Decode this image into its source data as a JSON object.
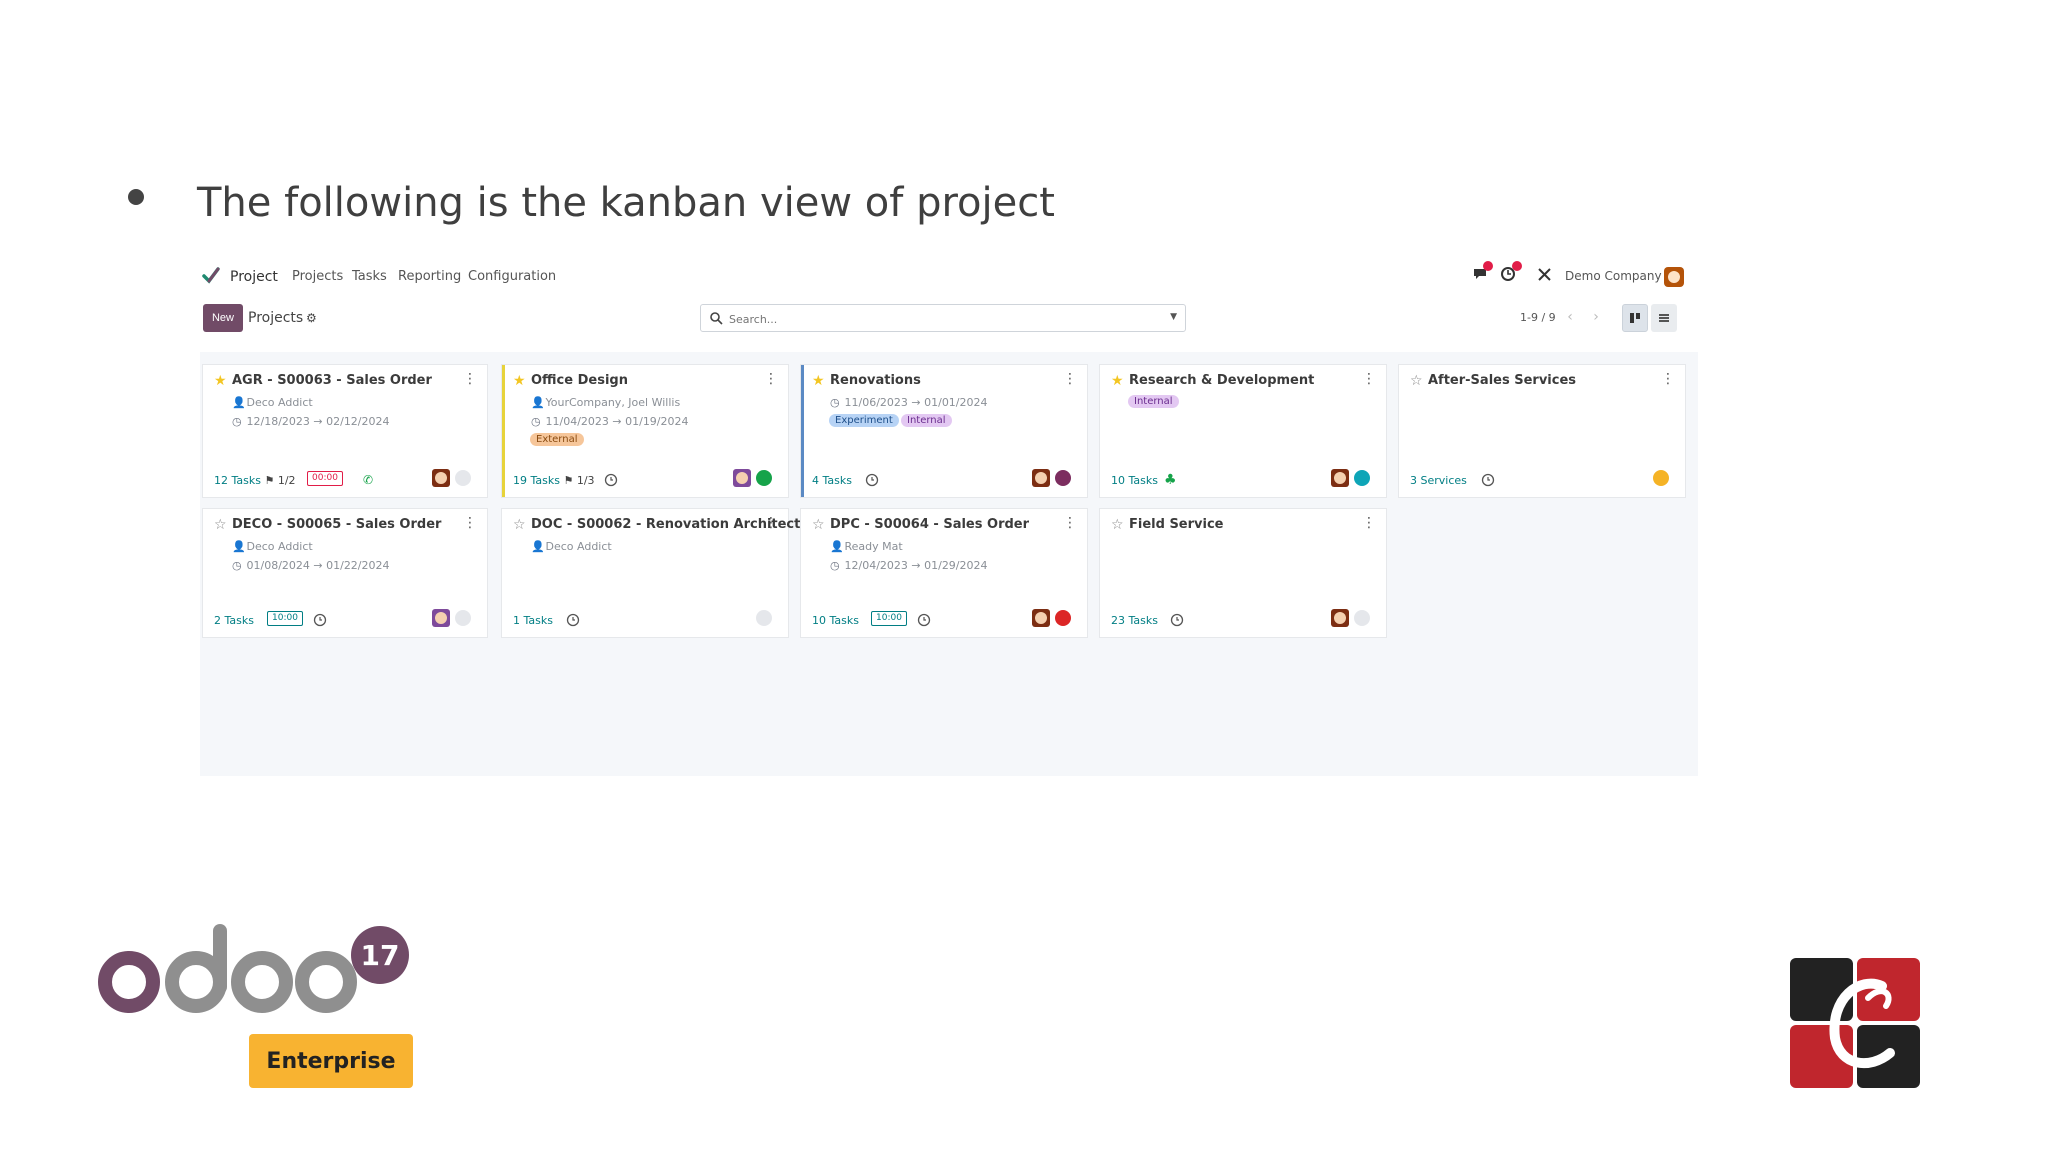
{
  "slide": {
    "heading": "The following is the kanban view of project"
  },
  "topnav": {
    "app": "Project",
    "menu": [
      "Projects",
      "Tasks",
      "Reporting",
      "Configuration"
    ],
    "company": "Demo Company"
  },
  "control": {
    "new_label": "New",
    "breadcrumb": "Projects",
    "search_placeholder": "Search...",
    "pager": "1-9 / 9"
  },
  "colors": {
    "primary": "#714b67",
    "link": "#017e84",
    "board_bg": "#f5f7fa"
  },
  "cards": [
    {
      "title": "AGR - S00063 - Sales Order",
      "favorite": true,
      "customer": "Deco Addict",
      "dates": "12/18/2023 → 02/12/2024",
      "tasks": "12 Tasks",
      "milestones": "1/2",
      "hours": "00:00",
      "hours_color": "#e11d48",
      "status_color": "#e5e7eb"
    },
    {
      "title": "Office Design",
      "favorite": true,
      "customer": "YourCompany, Joel Willis",
      "dates": "11/04/2023 → 01/19/2024",
      "tag": "External",
      "tasks": "19 Tasks",
      "milestones": "1/3",
      "status_color": "#16a34a",
      "bar_color": "#e7d33a"
    },
    {
      "title": "Renovations",
      "favorite": true,
      "dates": "11/06/2023 → 01/01/2024",
      "tags": [
        "Experiment",
        "Internal"
      ],
      "tasks": "4 Tasks",
      "status_color": "#7c2d5f",
      "bar_color": "#5b8ac4"
    },
    {
      "title": "Research & Development",
      "favorite": true,
      "tag": "Internal",
      "tasks": "10 Tasks",
      "status_color": "#0ea5b7"
    },
    {
      "title": "After-Sales Services",
      "favorite": false,
      "tasks": "3 Services",
      "status_color": "#f5b326"
    },
    {
      "title": "DECO - S00065 - Sales Order",
      "favorite": false,
      "customer": "Deco Addict",
      "dates": "01/08/2024 → 01/22/2024",
      "tasks": "2 Tasks",
      "hours": "10:00",
      "hours_color": "#017e84",
      "status_color": "#e5e7eb"
    },
    {
      "title": "DOC - S00062 - Renovation Architect (...)",
      "favorite": false,
      "customer": "Deco Addict",
      "tasks": "1 Tasks",
      "status_color": "#e5e7eb"
    },
    {
      "title": "DPC - S00064 - Sales Order",
      "favorite": false,
      "customer": "Ready Mat",
      "dates": "12/04/2023 → 01/29/2024",
      "tasks": "10 Tasks",
      "hours": "10:00",
      "hours_color": "#017e84",
      "status_color": "#dc2626"
    },
    {
      "title": "Field Service",
      "favorite": false,
      "tasks": "23 Tasks",
      "status_color": "#e5e7eb"
    }
  ],
  "branding": {
    "logo_word": "odoo",
    "version": "17",
    "edition": "Enterprise"
  }
}
